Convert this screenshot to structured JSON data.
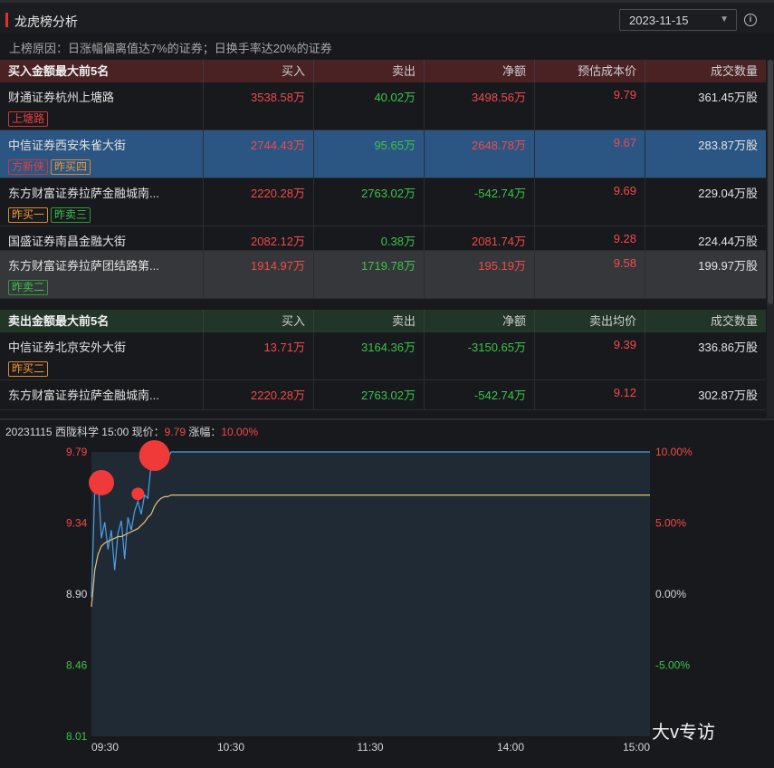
{
  "header": {
    "title": "龙虎榜分析",
    "date": "2023-11-15"
  },
  "reason": "上榜原因：日涨幅偏离值达7%的证券；日换手率达20%的证券",
  "buy_table": {
    "headers": [
      "买入金额最大前5名",
      "买入",
      "卖出",
      "净额",
      "预估成本价",
      "成交数量"
    ],
    "rows": [
      {
        "name": "财通证券杭州上塘路",
        "buy": "3538.58万",
        "sell": "40.02万",
        "net": "3498.56万",
        "price": "9.79",
        "vol": "361.45万股",
        "tags": [
          {
            "t": "上塘路",
            "c": "r"
          }
        ]
      },
      {
        "name": "中信证券西安朱雀大街",
        "buy": "2744.43万",
        "sell": "95.65万",
        "net": "2648.78万",
        "price": "9.67",
        "vol": "283.87万股",
        "tags": [
          {
            "t": "方新侠",
            "c": "r"
          },
          {
            "t": "昨买四",
            "c": "o"
          }
        ]
      },
      {
        "name": "东方财富证券拉萨金融城南...",
        "buy": "2220.28万",
        "sell": "2763.02万",
        "net": "-542.74万",
        "price": "9.69",
        "vol": "229.04万股",
        "tags": [
          {
            "t": "昨买一",
            "c": "o"
          },
          {
            "t": "昨卖三",
            "c": "g"
          }
        ]
      },
      {
        "name": "国盛证券南昌金融大街",
        "buy": "2082.12万",
        "sell": "0.38万",
        "net": "2081.74万",
        "price": "9.28",
        "vol": "224.44万股",
        "tags": []
      },
      {
        "name": "东方财富证券拉萨团结路第...",
        "buy": "1914.97万",
        "sell": "1719.78万",
        "net": "195.19万",
        "price": "9.58",
        "vol": "199.97万股",
        "tags": [
          {
            "t": "昨卖二",
            "c": "g"
          }
        ]
      }
    ]
  },
  "sell_table": {
    "headers": [
      "卖出金额最大前5名",
      "买入",
      "卖出",
      "净额",
      "卖出均价",
      "成交数量"
    ],
    "rows": [
      {
        "name": "中信证券北京安外大街",
        "buy": "13.71万",
        "sell": "3164.36万",
        "net": "-3150.65万",
        "price": "9.39",
        "vol": "336.86万股",
        "tags": [
          {
            "t": "昨买二",
            "c": "o"
          }
        ]
      },
      {
        "name": "东方财富证券拉萨金融城南...",
        "buy": "2220.28万",
        "sell": "2763.02万",
        "net": "-542.74万",
        "price": "9.12",
        "vol": "302.87万股",
        "tags": []
      }
    ]
  },
  "chart_info": {
    "prefix": "20231115 西陇科学 15:00 现价：",
    "price": "9.79",
    "chg_label": " 涨幅：",
    "chg": "10.00%"
  },
  "chart_data": {
    "type": "line",
    "x_labels": [
      "09:30",
      "10:30",
      "11:30",
      "14:00",
      "15:00"
    ],
    "y_labels": [
      "9.79",
      "9.34",
      "8.90",
      "8.46",
      "8.01"
    ],
    "right_labels": [
      "10.00%",
      "5.00%",
      "0.00%",
      "-5.00%"
    ],
    "ylim": [
      8.01,
      9.79
    ],
    "series": [
      {
        "color": "#4fa0e6",
        "values": [
          8.88,
          9.55,
          9.62,
          9.25,
          9.35,
          9.18,
          9.3,
          9.05,
          9.28,
          9.36,
          9.12,
          9.38,
          9.3,
          9.42,
          9.48,
          9.4,
          9.52,
          9.5,
          9.72,
          9.79,
          9.79,
          9.7,
          9.79,
          9.75,
          9.79,
          9.79,
          9.79,
          9.79,
          9.79,
          9.79,
          9.79
        ]
      },
      {
        "color": "#e6c27a",
        "values": [
          8.82,
          9.05,
          9.15,
          9.2,
          9.22,
          9.23,
          9.24,
          9.25,
          9.26,
          9.26,
          9.27,
          9.28,
          9.29,
          9.3,
          9.31,
          9.33,
          9.35,
          9.38,
          9.4,
          9.45,
          9.48,
          9.5,
          9.51,
          9.51,
          9.52,
          9.52,
          9.52,
          9.52,
          9.52,
          9.52,
          9.52
        ]
      }
    ],
    "events": [
      {
        "i": 3,
        "v": 9.62,
        "r": 14
      },
      {
        "i": 14,
        "v": 9.55,
        "r": 7
      },
      {
        "i": 19,
        "v": 9.79,
        "r": 17
      }
    ]
  },
  "watermark": "大v专访"
}
